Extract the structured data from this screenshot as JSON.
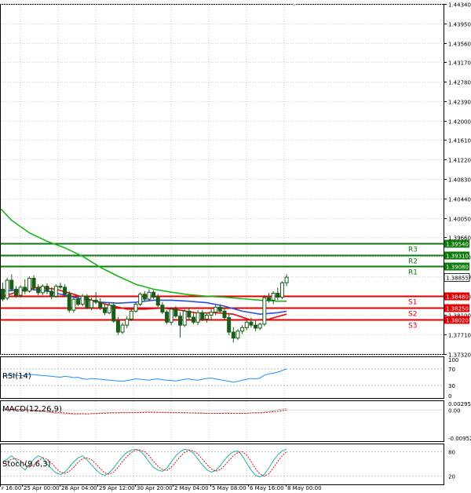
{
  "chart_data": {
    "type": "candlestick",
    "instrument_timeframe": "",
    "price_axis": {
      "min": 1.3732,
      "max": 1.4434,
      "ticks": [
        "1.44340",
        "1.43950",
        "1.43560",
        "1.43170",
        "1.42780",
        "1.42390",
        "1.42000",
        "1.41610",
        "1.41220",
        "1.40830",
        "1.40440",
        "1.40050",
        "1.39660",
        "1.39270",
        "1.38880",
        "1.38490",
        "1.38100",
        "1.37710",
        "1.37320"
      ]
    },
    "time_axis": {
      "labels": [
        "r 16:00",
        "25 Apr 00:00",
        "28 Apr 04:00",
        "29 Apr 12:00",
        "30 Apr 20:00",
        "2 May 04:00",
        "5 May 08:00",
        "6 May 16:00",
        "8 May 00:00"
      ]
    },
    "current_price": "1.38855",
    "levels": [
      {
        "name": "R3",
        "value": 1.3954,
        "label": "1.39540",
        "color": "#0b7a0b"
      },
      {
        "name": "R2",
        "value": 1.3931,
        "label": "1.39310",
        "color": "#0b7a0b"
      },
      {
        "name": "R1",
        "value": 1.3908,
        "label": "1.39080",
        "color": "#0b7a0b"
      },
      {
        "name": "S1",
        "value": 1.3848,
        "label": "1.38480",
        "color": "#e00000"
      },
      {
        "name": "S2",
        "value": 1.3825,
        "label": "1.38250",
        "color": "#e00000"
      },
      {
        "name": "S3",
        "value": 1.3802,
        "label": "1.38020",
        "color": "#e00000"
      }
    ],
    "candles": [
      [
        1.3862,
        1.3875,
        1.3838,
        1.3842
      ],
      [
        1.3844,
        1.3885,
        1.384,
        1.388
      ],
      [
        1.388,
        1.3892,
        1.3858,
        1.3862
      ],
      [
        1.3862,
        1.3868,
        1.3845,
        1.385
      ],
      [
        1.385,
        1.387,
        1.3845,
        1.3866
      ],
      [
        1.3866,
        1.3882,
        1.3852,
        1.3858
      ],
      [
        1.3858,
        1.3888,
        1.3855,
        1.3884
      ],
      [
        1.3884,
        1.389,
        1.386,
        1.3865
      ],
      [
        1.3865,
        1.3872,
        1.385,
        1.3855
      ],
      [
        1.3855,
        1.3872,
        1.385,
        1.3868
      ],
      [
        1.3868,
        1.3874,
        1.3852,
        1.3858
      ],
      [
        1.3858,
        1.3866,
        1.3842,
        1.3848
      ],
      [
        1.3848,
        1.3872,
        1.3845,
        1.3868
      ],
      [
        1.3868,
        1.3875,
        1.3862,
        1.3866
      ],
      [
        1.3866,
        1.3872,
        1.3848,
        1.3852
      ],
      [
        1.3852,
        1.3858,
        1.3815,
        1.382
      ],
      [
        1.382,
        1.3846,
        1.3815,
        1.3842
      ],
      [
        1.3842,
        1.385,
        1.3828,
        1.3832
      ],
      [
        1.3832,
        1.3852,
        1.3828,
        1.3848
      ],
      [
        1.3848,
        1.3852,
        1.3822,
        1.3825
      ],
      [
        1.3825,
        1.3845,
        1.382,
        1.384
      ],
      [
        1.384,
        1.3856,
        1.3832,
        1.3836
      ],
      [
        1.3836,
        1.3844,
        1.382,
        1.3825
      ],
      [
        1.3825,
        1.3832,
        1.381,
        1.3815
      ],
      [
        1.3815,
        1.3835,
        1.3812,
        1.383
      ],
      [
        1.383,
        1.3836,
        1.3795,
        1.3798
      ],
      [
        1.3798,
        1.3806,
        1.377,
        1.3776
      ],
      [
        1.3776,
        1.3795,
        1.3772,
        1.379
      ],
      [
        1.379,
        1.3808,
        1.3784,
        1.3802
      ],
      [
        1.3802,
        1.3822,
        1.3798,
        1.3818
      ],
      [
        1.3818,
        1.3836,
        1.3815,
        1.3832
      ],
      [
        1.3832,
        1.3856,
        1.3828,
        1.3852
      ],
      [
        1.3852,
        1.3858,
        1.3838,
        1.3842
      ],
      [
        1.3842,
        1.3862,
        1.3838,
        1.3856
      ],
      [
        1.3856,
        1.386,
        1.3842,
        1.3846
      ],
      [
        1.3846,
        1.3852,
        1.3826,
        1.383
      ],
      [
        1.383,
        1.3836,
        1.3812,
        1.3816
      ],
      [
        1.3816,
        1.382,
        1.3792,
        1.3796
      ],
      [
        1.3796,
        1.3826,
        1.379,
        1.3822
      ],
      [
        1.3822,
        1.3828,
        1.3805,
        1.3808
      ],
      [
        1.3808,
        1.3816,
        1.3765,
        1.379
      ],
      [
        1.379,
        1.3822,
        1.3786,
        1.3818
      ],
      [
        1.3818,
        1.3824,
        1.38,
        1.3806
      ],
      [
        1.3806,
        1.3814,
        1.3792,
        1.3796
      ],
      [
        1.3796,
        1.382,
        1.379,
        1.3815
      ],
      [
        1.3815,
        1.382,
        1.3798,
        1.3802
      ],
      [
        1.3802,
        1.3815,
        1.3795,
        1.381
      ],
      [
        1.381,
        1.3822,
        1.38,
        1.3816
      ],
      [
        1.3816,
        1.383,
        1.381,
        1.3826
      ],
      [
        1.3826,
        1.3832,
        1.3815,
        1.3818
      ],
      [
        1.3818,
        1.3825,
        1.38,
        1.3805
      ],
      [
        1.3805,
        1.3812,
        1.377,
        1.3776
      ],
      [
        1.3776,
        1.3786,
        1.3755,
        1.3764
      ],
      [
        1.3764,
        1.3782,
        1.376,
        1.3778
      ],
      [
        1.3778,
        1.379,
        1.3772,
        1.3785
      ],
      [
        1.3785,
        1.38,
        1.378,
        1.3796
      ],
      [
        1.3796,
        1.3805,
        1.3785,
        1.379
      ],
      [
        1.379,
        1.38,
        1.3778,
        1.3784
      ],
      [
        1.3784,
        1.3795,
        1.378,
        1.3792
      ],
      [
        1.3792,
        1.385,
        1.3788,
        1.3845
      ],
      [
        1.3845,
        1.3855,
        1.3835,
        1.384
      ],
      [
        1.384,
        1.3858,
        1.3832,
        1.3854
      ],
      [
        1.3854,
        1.3865,
        1.384,
        1.3846
      ],
      [
        1.3846,
        1.3878,
        1.3842,
        1.3875
      ],
      [
        1.3875,
        1.3892,
        1.3868,
        1.3886
      ]
    ],
    "moving_averages": [
      {
        "color": "#1db41d",
        "points": [
          [
            -8,
            1.4023
          ],
          [
            2,
            1.4
          ],
          [
            6,
            1.3975
          ],
          [
            10,
            1.3958
          ],
          [
            14,
            1.3945
          ],
          [
            18,
            1.3928
          ],
          [
            22,
            1.3906
          ],
          [
            26,
            1.3888
          ],
          [
            30,
            1.3872
          ],
          [
            34,
            1.3862
          ],
          [
            38,
            1.3856
          ],
          [
            42,
            1.3851
          ],
          [
            46,
            1.3848
          ],
          [
            50,
            1.3846
          ],
          [
            54,
            1.3843
          ],
          [
            58,
            1.384
          ],
          [
            62,
            1.3838
          ],
          [
            64,
            1.3838
          ]
        ]
      },
      {
        "color": "#2e4fd6",
        "points": [
          [
            0,
            1.3858
          ],
          [
            6,
            1.3862
          ],
          [
            10,
            1.3858
          ],
          [
            14,
            1.385
          ],
          [
            18,
            1.3842
          ],
          [
            22,
            1.3836
          ],
          [
            26,
            1.3834
          ],
          [
            30,
            1.3836
          ],
          [
            34,
            1.384
          ],
          [
            38,
            1.384
          ],
          [
            42,
            1.3838
          ],
          [
            46,
            1.3835
          ],
          [
            50,
            1.3828
          ],
          [
            54,
            1.3818
          ],
          [
            58,
            1.3812
          ],
          [
            62,
            1.3815
          ],
          [
            64,
            1.3818
          ]
        ]
      },
      {
        "color": "#e01010",
        "points": [
          [
            0,
            1.3848
          ],
          [
            4,
            1.3858
          ],
          [
            8,
            1.3866
          ],
          [
            12,
            1.3862
          ],
          [
            16,
            1.3852
          ],
          [
            20,
            1.384
          ],
          [
            24,
            1.383
          ],
          [
            28,
            1.3822
          ],
          [
            32,
            1.3822
          ],
          [
            36,
            1.3824
          ],
          [
            40,
            1.382
          ],
          [
            44,
            1.3814
          ],
          [
            48,
            1.3815
          ],
          [
            52,
            1.3812
          ],
          [
            56,
            1.38
          ],
          [
            60,
            1.3802
          ],
          [
            64,
            1.3812
          ]
        ]
      }
    ],
    "rsi": {
      "label": "RSI(14)",
      "ticks": [
        "100",
        "70",
        "30",
        "0"
      ],
      "levels": [
        70,
        30
      ],
      "values": [
        52,
        54,
        56,
        55,
        53,
        55,
        57,
        56,
        55,
        54,
        53,
        52,
        51,
        50,
        52,
        51,
        49,
        50,
        46,
        45,
        47,
        46,
        45,
        44,
        43,
        42,
        41,
        40,
        42,
        44,
        46,
        45,
        44,
        43,
        45,
        46,
        44,
        43,
        42,
        41,
        43,
        45,
        46,
        44,
        43,
        45,
        47,
        48,
        46,
        44,
        42,
        40,
        38,
        40,
        43,
        45,
        47,
        46,
        48,
        55,
        58,
        60,
        62,
        66,
        70
      ]
    },
    "macd": {
      "label": "MACD(12,26,9)",
      "ticks": [
        "0.002952",
        "0.00",
        "-0.009528"
      ],
      "min": -0.009528,
      "max": 0.002952,
      "values": [
        0.0001,
        0.0002,
        0.0003,
        0.0003,
        0.0002,
        0.0001,
        0,
        -0.0002,
        -0.0003,
        -0.0005,
        -0.0007,
        -0.0008,
        -0.001,
        -0.0011,
        -0.0012,
        -0.0012,
        -0.0013,
        -0.0013,
        -0.0012,
        -0.0012,
        -0.0011,
        -0.001,
        -0.0009,
        -0.0008,
        -0.0008,
        -0.0008,
        -0.0007,
        -0.0007,
        -0.0008,
        -0.0008,
        -0.0007,
        -0.0007,
        -0.0006,
        -0.0006,
        -0.0006,
        -0.0007,
        -0.0007,
        -0.0008,
        -0.0008,
        -0.0008,
        -0.0009,
        -0.0009,
        -0.0009,
        -0.0009,
        -0.001,
        -0.001,
        -0.001,
        -0.001,
        -0.001,
        -0.001,
        -0.0009,
        -0.0009,
        -0.001,
        -0.001,
        -0.001,
        -0.0009,
        -0.0009,
        -0.0008,
        -0.0008,
        -0.0006,
        -0.0004,
        -0.0002,
        0.0001,
        0.0003,
        0.0005
      ],
      "signal": [
        0.0001,
        0.0001,
        0.0002,
        0.0002,
        0.0002,
        0.0001,
        0,
        -0.0001,
        -0.0002,
        -0.0003,
        -0.0004,
        -0.0006,
        -0.0007,
        -0.0008,
        -0.0009,
        -0.001,
        -0.0011,
        -0.0011,
        -0.0011,
        -0.0012,
        -0.0011,
        -0.0011,
        -0.001,
        -0.001,
        -0.0009,
        -0.0009,
        -0.0009,
        -0.0008,
        -0.0008,
        -0.0008,
        -0.0008,
        -0.0008,
        -0.0007,
        -0.0007,
        -0.0007,
        -0.0007,
        -0.0007,
        -0.0007,
        -0.0008,
        -0.0008,
        -0.0008,
        -0.0008,
        -0.0009,
        -0.0009,
        -0.0009,
        -0.0009,
        -0.001,
        -0.001,
        -0.001,
        -0.001,
        -0.001,
        -0.001,
        -0.001,
        -0.001,
        -0.001,
        -0.001,
        -0.0009,
        -0.0009,
        -0.0009,
        -0.0008,
        -0.0007,
        -0.0005,
        -0.0004,
        -0.0002,
        0
      ]
    },
    "stoch": {
      "label": "Stoch(9,6,3)",
      "ticks": [
        "80",
        "20"
      ],
      "levels": [
        80,
        20
      ],
      "k": [
        55,
        62,
        70,
        60,
        45,
        35,
        48,
        62,
        70,
        65,
        50,
        38,
        28,
        24,
        30,
        42,
        55,
        65,
        70,
        60,
        48,
        36,
        26,
        22,
        28,
        40,
        55,
        68,
        78,
        84,
        86,
        82,
        70,
        55,
        42,
        35,
        32,
        40,
        55,
        70,
        80,
        86,
        84,
        76,
        62,
        48,
        36,
        30,
        34,
        45,
        60,
        72,
        80,
        82,
        70,
        52,
        35,
        22,
        18,
        25,
        40,
        58,
        72,
        82,
        86
      ],
      "d": [
        50,
        56,
        62,
        63,
        58,
        48,
        42,
        48,
        58,
        65,
        62,
        52,
        40,
        30,
        27,
        32,
        42,
        54,
        63,
        65,
        60,
        50,
        38,
        28,
        25,
        30,
        42,
        56,
        68,
        78,
        84,
        84,
        80,
        70,
        56,
        44,
        36,
        34,
        42,
        55,
        68,
        78,
        84,
        82,
        74,
        62,
        49,
        38,
        32,
        36,
        46,
        58,
        70,
        78,
        80,
        72,
        56,
        38,
        25,
        20,
        26,
        40,
        56,
        70,
        80
      ]
    }
  }
}
